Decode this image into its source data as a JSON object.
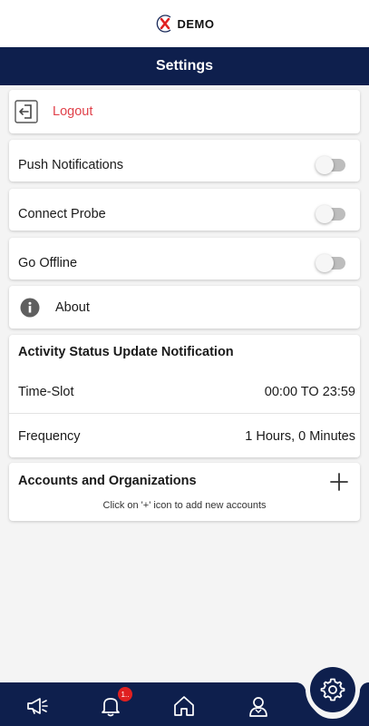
{
  "header": {
    "logo_text": "DEMO",
    "title": "Settings"
  },
  "settings": {
    "logout_label": "Logout",
    "push_notifications_label": "Push Notifications",
    "connect_probe_label": "Connect Probe",
    "go_offline_label": "Go Offline",
    "about_label": "About"
  },
  "activity": {
    "title": "Activity Status Update Notification",
    "time_slot_label": "Time-Slot",
    "time_slot_value": "00:00 TO 23:59",
    "frequency_label": "Frequency",
    "frequency_value": "1 Hours, 0 Minutes"
  },
  "accounts": {
    "title": "Accounts and Organizations",
    "hint": "Click on '+' icon to add new accounts"
  },
  "nav": {
    "notification_badge": "1.."
  },
  "colors": {
    "brand_navy": "#0e1f4d",
    "logout_red": "#e0414a",
    "badge_red": "#e02020"
  }
}
